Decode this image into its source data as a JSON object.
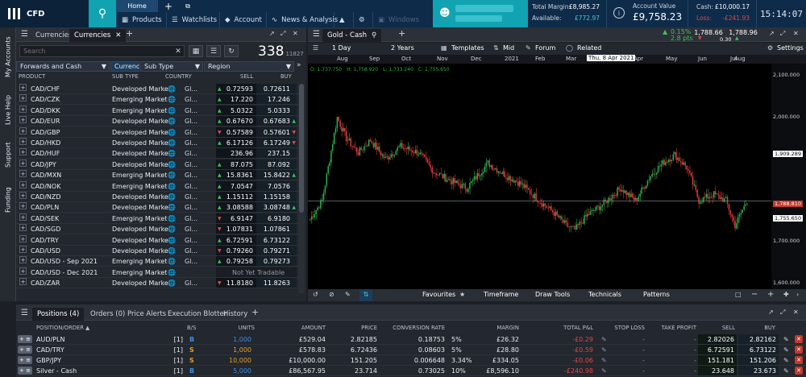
{
  "app": {
    "brand": "CFD"
  },
  "nav": {
    "home": "Home",
    "items": [
      "Products",
      "Watchlists",
      "Account",
      "News & Analysis"
    ],
    "windows": "Windows"
  },
  "account": {
    "total_margin_label": "Total Margin:",
    "total_margin": "£8,985.27",
    "available_label": "Available:",
    "available": "£772.97",
    "value_label": "Account Value",
    "value": "£9,758.23",
    "cash_label": "Cash:",
    "cash": "£10,000.17",
    "loss_label": "Loss:",
    "loss": "-£241.93",
    "clock": "15:14:07"
  },
  "side_rail": [
    "My Accounts",
    "Live Help",
    "Support",
    "Funding"
  ],
  "left_panel": {
    "tabs": [
      "Currencies",
      "Currencies"
    ],
    "search_placeholder": "Search",
    "count": "338",
    "count_total": "11827",
    "selects": [
      "Forwards and Cash",
      "Currencies",
      "Sub Type",
      "Region"
    ],
    "columns": [
      "PRODUCT",
      "SUB TYPE",
      "COUNTRY",
      "SELL",
      "BUY"
    ],
    "rows": [
      {
        "name": "CAD/CHF",
        "sub": "Developed Marke",
        "gl": "Gl...",
        "sell": "0.72593",
        "buy": "0.72611",
        "sd": "up",
        "bd": ""
      },
      {
        "name": "CAD/CZK",
        "sub": "Emerging Market",
        "gl": "Gl...",
        "sell": "17.220",
        "buy": "17.246",
        "sd": "up",
        "bd": ""
      },
      {
        "name": "CAD/DKK",
        "sub": "Emerging Market",
        "gl": "Gl...",
        "sell": "5.0322",
        "buy": "5.0333",
        "sd": "up",
        "bd": ""
      },
      {
        "name": "CAD/EUR",
        "sub": "Developed Marke",
        "gl": "Gl...",
        "sell": "0.67670",
        "buy": "0.67683",
        "sd": "up",
        "bd": "up"
      },
      {
        "name": "CAD/GBP",
        "sub": "Developed Marke",
        "gl": "Gl...",
        "sell": "0.57589",
        "buy": "0.57601",
        "sd": "dn",
        "bd": "dn"
      },
      {
        "name": "CAD/HKD",
        "sub": "Developed Marke",
        "gl": "Gl...",
        "sell": "6.17126",
        "buy": "6.17249",
        "sd": "up",
        "bd": "dn"
      },
      {
        "name": "CAD/HUF",
        "sub": "Developed Marke",
        "gl": "Gl...",
        "sell": "236.96",
        "buy": "237.15",
        "sd": "",
        "bd": ""
      },
      {
        "name": "CAD/JPY",
        "sub": "Developed Marke",
        "gl": "Gl...",
        "sell": "87.075",
        "buy": "87.092",
        "sd": "up",
        "bd": ""
      },
      {
        "name": "CAD/MXN",
        "sub": "Emerging Market",
        "gl": "Gl...",
        "sell": "15.8361",
        "buy": "15.8422",
        "sd": "up",
        "bd": "up"
      },
      {
        "name": "CAD/NOK",
        "sub": "Emerging Market",
        "gl": "Gl...",
        "sell": "7.0547",
        "buy": "7.0576",
        "sd": "up",
        "bd": ""
      },
      {
        "name": "CAD/NZD",
        "sub": "Developed Marke",
        "gl": "Gl...",
        "sell": "1.15112",
        "buy": "1.15158",
        "sd": "up",
        "bd": ""
      },
      {
        "name": "CAD/PLN",
        "sub": "Developed Marke",
        "gl": "Gl...",
        "sell": "3.08588",
        "buy": "3.08748",
        "sd": "up",
        "bd": "up"
      },
      {
        "name": "CAD/SEK",
        "sub": "Emerging Market",
        "gl": "Gl...",
        "sell": "6.9147",
        "buy": "6.9180",
        "sd": "dn",
        "bd": ""
      },
      {
        "name": "CAD/SGD",
        "sub": "Developed Marke",
        "gl": "Gl...",
        "sell": "1.07831",
        "buy": "1.07861",
        "sd": "dn",
        "bd": ""
      },
      {
        "name": "CAD/TRY",
        "sub": "Developed Marke",
        "gl": "Gl...",
        "sell": "6.72591",
        "buy": "6.73122",
        "sd": "up",
        "bd": ""
      },
      {
        "name": "CAD/USD",
        "sub": "Developed Marke",
        "gl": "Gl...",
        "sell": "0.79260",
        "buy": "0.79271",
        "sd": "dn",
        "bd": ""
      },
      {
        "name": "CAD/USD - Sep 2021",
        "sub": "Emerging Market",
        "gl": "Gl...",
        "sell": "0.79258",
        "buy": "0.79273",
        "sd": "up",
        "bd": ""
      },
      {
        "name": "CAD/USD - Dec 2021",
        "sub": "Emerging Market",
        "gl": "",
        "sell": "Not Yet Tradable",
        "buy": "",
        "sd": "",
        "bd": ""
      },
      {
        "name": "CAD/ZAR",
        "sub": "Developed Marke",
        "gl": "Gl...",
        "sell": "11.8180",
        "buy": "11.8263",
        "sd": "dn",
        "bd": ""
      }
    ]
  },
  "chart": {
    "instrument": "Gold - Cash",
    "interval": "1 Day",
    "range": "2 Years",
    "templates": "Templates",
    "price_mode": "Mid",
    "forum": "Forum",
    "related": "Related",
    "settings": "Settings",
    "change_pct": "0.15%",
    "change_pts": "2.8 pts",
    "sell": "1,788.66",
    "buy": "1,788.96",
    "spread": "0.30",
    "ohlc": {
      "o": "O: 1,737.750",
      "h": "H: 1,758.920",
      "l": "L: 1,733.240",
      "c": "C: 1,755.650"
    },
    "time_labels": [
      "Aug",
      "Sep",
      "Oct",
      "Nov",
      "Dec",
      "2021",
      "Feb",
      "Mar",
      "Apr",
      "May",
      "Jun",
      "Jul",
      "Aug"
    ],
    "crosshair_date": "Thu, 8 Apr 2021",
    "y_labels": [
      "2,100.000",
      "2,000.000",
      "1,909.289",
      "1,788.810",
      "1,755.650",
      "1,700.000",
      "1,600.000"
    ],
    "bottom_tools": [
      "Favourites",
      "Timeframe",
      "Draw Tools",
      "Technicals",
      "Patterns"
    ],
    "colors": {
      "up": "#2bb24c",
      "down": "#e23b3b",
      "bg": "#000000"
    }
  },
  "bottom": {
    "tabs": [
      "Positions (4)",
      "Orders (0)",
      "Price Alerts",
      "Execution Blotter",
      "History"
    ],
    "columns": [
      "POSITION/ORDER",
      "B/S",
      "UNITS",
      "AMOUNT",
      "PRICE",
      "CONVERSION RATE",
      "MARGIN",
      "TOTAL P&L",
      "STOP LOSS",
      "TAKE PROFIT",
      "SELL",
      "BUY"
    ],
    "rows": [
      {
        "name": "AUD/PLN",
        "n": "[1]",
        "bs": "B",
        "units": "1,000",
        "amount": "£529.04",
        "price": "2.82185",
        "conv": "0.18753",
        "pct": "5%",
        "margin": "£26.32",
        "pl": "-£0.29",
        "stop": "-",
        "tp": "-",
        "sell": "2.82026",
        "buy": "2.82162"
      },
      {
        "name": "CAD/TRY",
        "n": "[1]",
        "bs": "S",
        "units": "1,000",
        "amount": "£578.83",
        "price": "6.72436",
        "conv": "0.08603",
        "pct": "5%",
        "margin": "£28.80",
        "pl": "-£0.59",
        "stop": "-",
        "tp": "-",
        "sell": "6.72591",
        "buy": "6.73122"
      },
      {
        "name": "GBP/JPY",
        "n": "[1]",
        "bs": "S",
        "units": "10,000",
        "amount": "£10,000.00",
        "price": "151.205",
        "conv": "0.006648",
        "pct": "3.34%",
        "margin": "£334.05",
        "pl": "-£0.06",
        "stop": "-",
        "tp": "-",
        "sell": "151.181",
        "buy": "151.206"
      },
      {
        "name": "Silver - Cash",
        "n": "[1]",
        "bs": "B",
        "units": "5,000",
        "amount": "£86,567.95",
        "price": "23.714",
        "conv": "0.73025",
        "pct": "10%",
        "margin": "£8,596.10",
        "pl": "-£240.98",
        "stop": "-",
        "tp": "-",
        "sell": "23.648",
        "buy": "23.673"
      }
    ]
  }
}
